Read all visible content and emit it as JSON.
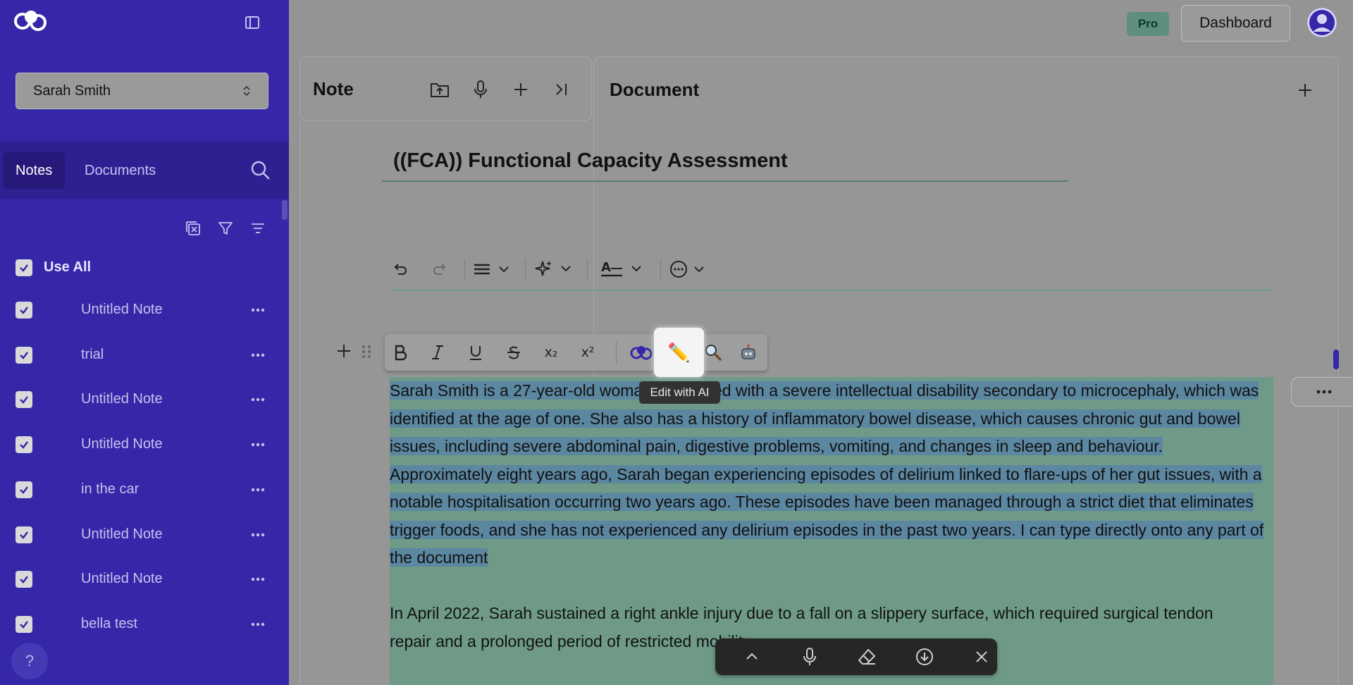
{
  "sidebar": {
    "user_name": "Sarah Smith",
    "tabs": {
      "notes": "Notes",
      "documents": "Documents"
    },
    "use_all_label": "Use All",
    "notes": [
      {
        "label": "Untitled Note"
      },
      {
        "label": "trial"
      },
      {
        "label": "Untitled Note"
      },
      {
        "label": "Untitled Note"
      },
      {
        "label": "in the car"
      },
      {
        "label": "Untitled Note"
      },
      {
        "label": "Untitled Note"
      },
      {
        "label": "bella test"
      }
    ],
    "help_label": "?"
  },
  "topbar": {
    "pro_badge": "Pro",
    "dashboard_label": "Dashboard"
  },
  "note_panel": {
    "title": "Note"
  },
  "document_panel": {
    "title": "Document",
    "doc_title": "((FCA)) Functional Capacity Assessment",
    "format_bar": {
      "subscript": "x₂",
      "superscript": "x²"
    },
    "edit_ai_icon": "✏️",
    "tooltip": "Edit with AI",
    "paragraph_1": "Sarah Smith is a 27-year-old woman diagnosed with a severe intellectual disability secondary to microcephaly, which was identified at the age of one. She also has a history of inflammatory bowel disease, which causes chronic gut and bowel issues, including severe abdominal pain, digestive problems, vomiting, and changes in sleep and behaviour. Approximately eight years ago, Sarah began experiencing episodes of delirium linked to flare-ups of her gut issues, with a notable hospitalisation occurring two years ago. These episodes have been managed through a strict diet that eliminates trigger foods, and she has not experienced any delirium episodes in the past two years. I can type directly onto any part of the document",
    "paragraph_2": "In April 2022, Sarah sustained a right ankle injury due to a fall on a slippery surface, which required surgical tendon repair and a prolonged period of restricted mobility."
  },
  "colors": {
    "sidebar_bg": "#3527a8",
    "selection_highlight": "#5c87a1",
    "block_bg": "#6f9a88",
    "pro_badge": "#5e8f7e"
  }
}
